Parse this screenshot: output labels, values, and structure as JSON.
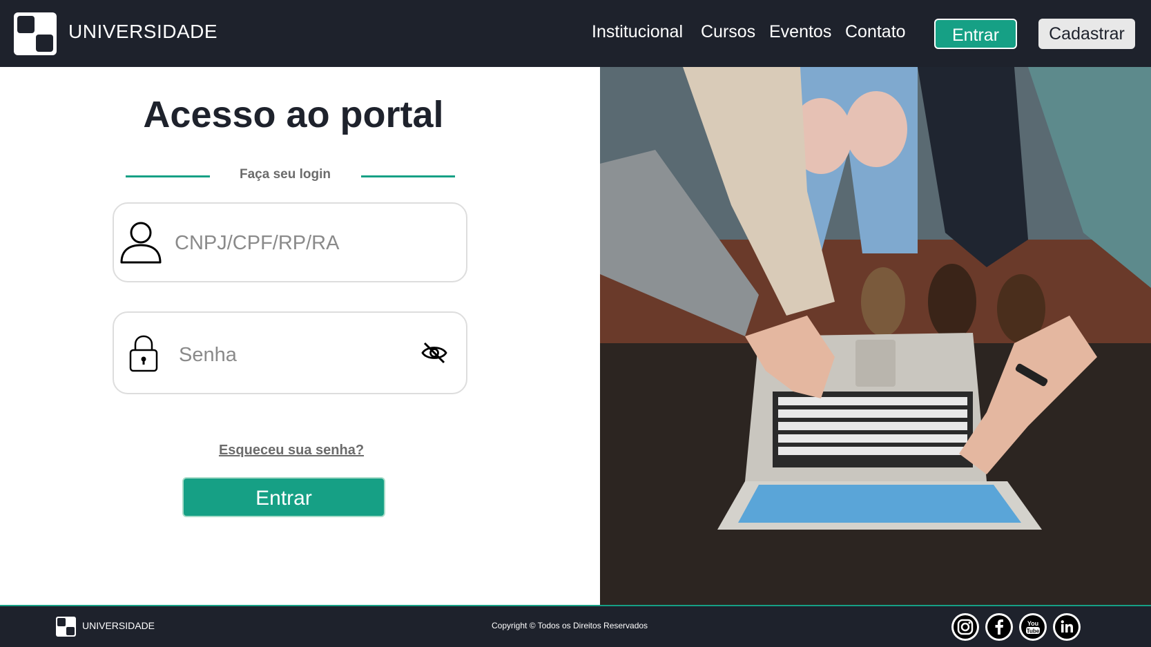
{
  "header": {
    "brand": "UNIVERSIDADE",
    "nav": [
      "Institucional",
      "Cursos",
      "Eventos",
      "Contato"
    ],
    "login_button": "Entrar",
    "signup_button": "Cadastrar"
  },
  "login": {
    "title": "Acesso ao portal",
    "subtitle": "Faça seu login",
    "user_placeholder": "CNPJ/CPF/RP/RA",
    "password_placeholder": "Senha",
    "forgot_link": "Esqueceu sua senha?",
    "submit_button": "Entrar",
    "icons": {
      "user": "user-icon",
      "password": "lock-icon",
      "toggle": "eye-slash-icon"
    }
  },
  "footer": {
    "brand": "UNIVERSIDADE",
    "copyright": "Copyright ©  Todos os Direitos Reservados",
    "social": [
      "instagram-icon",
      "facebook-icon",
      "youtube-icon",
      "linkedin-icon"
    ]
  },
  "colors": {
    "dark": "#1e222c",
    "accent": "#16a085",
    "light_button": "#e8e8e8"
  }
}
